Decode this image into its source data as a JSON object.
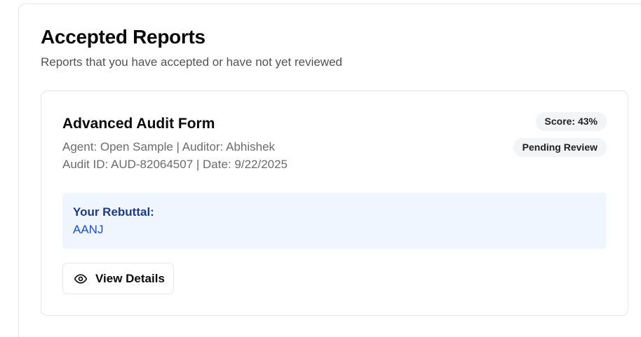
{
  "section": {
    "title": "Accepted Reports",
    "subtitle": "Reports that you have accepted or have not yet reviewed"
  },
  "report": {
    "title": "Advanced Audit Form",
    "meta_line_1": "Agent: Open Sample | Auditor: Abhishek",
    "meta_line_2": "Audit ID: AUD-82064507 | Date: 9/22/2025",
    "score_badge": "Score: 43%",
    "status_badge": "Pending Review",
    "rebuttal": {
      "label": "Your Rebuttal:",
      "text": "AANJ"
    },
    "view_button": {
      "label": "View Details",
      "icon": "eye-icon"
    }
  },
  "colors": {
    "rebuttal_bg": "#eff6ff",
    "rebuttal_label": "#1e3a8a",
    "rebuttal_text": "#1d4ed8",
    "badge_bg": "#f3f4f6"
  }
}
